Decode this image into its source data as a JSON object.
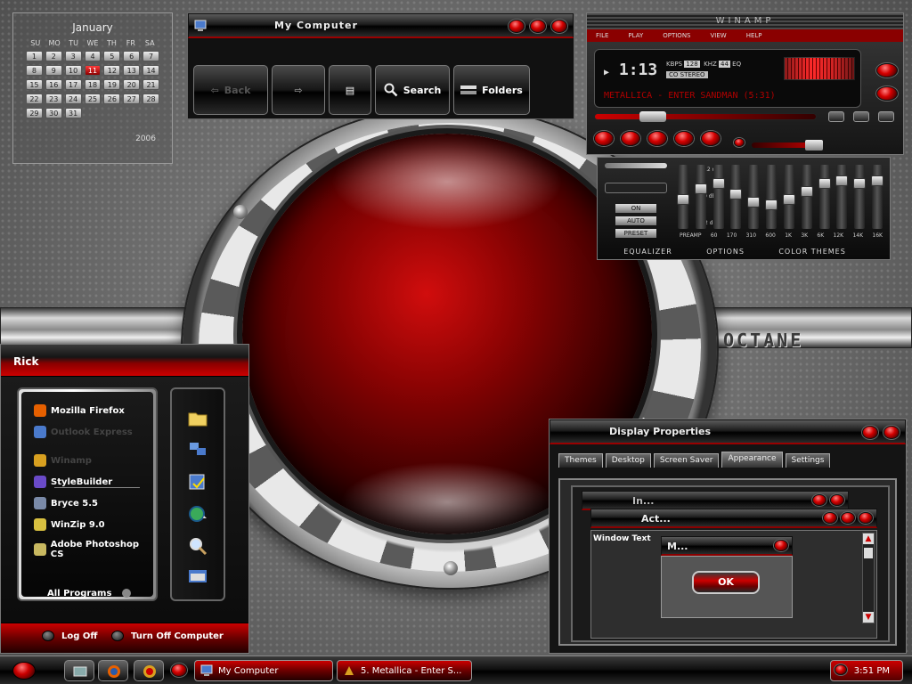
{
  "calendar": {
    "month": "January",
    "year": "2006",
    "dows": [
      "SU",
      "MO",
      "TU",
      "WE",
      "TH",
      "FR",
      "SA"
    ],
    "days": [
      "1",
      "2",
      "3",
      "4",
      "5",
      "6",
      "7",
      "8",
      "9",
      "10",
      "11",
      "12",
      "13",
      "14",
      "15",
      "16",
      "17",
      "18",
      "19",
      "20",
      "21",
      "22",
      "23",
      "24",
      "25",
      "26",
      "27",
      "28",
      "29",
      "30",
      "31"
    ],
    "today": "11"
  },
  "my_computer": {
    "title": "My Computer",
    "toolbar": {
      "back": "Back",
      "search": "Search",
      "folders": "Folders"
    }
  },
  "winamp": {
    "title": "WINAMP",
    "menu": [
      "FILE",
      "PLAY",
      "OPTIONS",
      "VIEW",
      "HELP"
    ],
    "time": "1:13",
    "kbps_label": "KBPS",
    "kbps": "128",
    "khz_label": "KHZ",
    "khz": "44",
    "eq_label": "EQ",
    "stereo": "CO STEREO",
    "song": "METALLICA - ENTER SANDMAN (5:31)"
  },
  "equalizer": {
    "db_top": "+12 db",
    "db_mid": "+0 db",
    "db_bot": "-12 db",
    "buttons": [
      "ON",
      "AUTO",
      "PRESET"
    ],
    "bands": [
      "PREAMP",
      "60",
      "170",
      "310",
      "600",
      "1K",
      "3K",
      "6K",
      "12K",
      "14K",
      "16K"
    ],
    "band_levels": [
      0.55,
      0.35,
      0.25,
      0.45,
      0.6,
      0.65,
      0.55,
      0.4,
      0.25,
      0.2,
      0.25,
      0.2
    ],
    "tabs": [
      "EQUALIZER",
      "OPTIONS",
      "COLOR THEMES"
    ]
  },
  "wallpaper_brand": "OCTANE",
  "start_menu": {
    "user": "Rick",
    "programs": [
      {
        "label": "Mozilla Firefox",
        "icon": "firefox-icon",
        "color": "#e66000",
        "dim": false
      },
      {
        "label": "Outlook Express",
        "icon": "outlook-icon",
        "color": "#4a7acc",
        "dim": true
      },
      {
        "label": "Winamp",
        "icon": "winamp-icon",
        "color": "#d8a020",
        "dim": true
      },
      {
        "label": "StyleBuilder",
        "icon": "stylebuilder-icon",
        "color": "#6a4ac8",
        "dim": false
      },
      {
        "label": "Bryce 5.5",
        "icon": "bryce-icon",
        "color": "#7a8aa8",
        "dim": false
      },
      {
        "label": "WinZip 9.0",
        "icon": "winzip-icon",
        "color": "#d8c040",
        "dim": false
      },
      {
        "label": "Adobe Photoshop CS",
        "icon": "photoshop-icon",
        "color": "#c8b860",
        "dim": false
      }
    ],
    "all_programs": "All Programs",
    "log_off": "Log Off",
    "turn_off": "Turn Off Computer"
  },
  "display_properties": {
    "title": "Display Properties",
    "tabs": [
      "Themes",
      "Desktop",
      "Screen Saver",
      "Appearance",
      "Settings"
    ],
    "active_tab": "Appearance",
    "preview": {
      "inactive": "In...",
      "active": "Act...",
      "window_text": "Window Text",
      "message": "M...",
      "ok": "OK"
    }
  },
  "taskbar": {
    "tasks": [
      "My Computer",
      "5. Metallica - Enter S..."
    ],
    "clock": "3:51 PM"
  },
  "colors": {
    "accent_red": "#cc0000",
    "dark_red": "#8a0000"
  }
}
